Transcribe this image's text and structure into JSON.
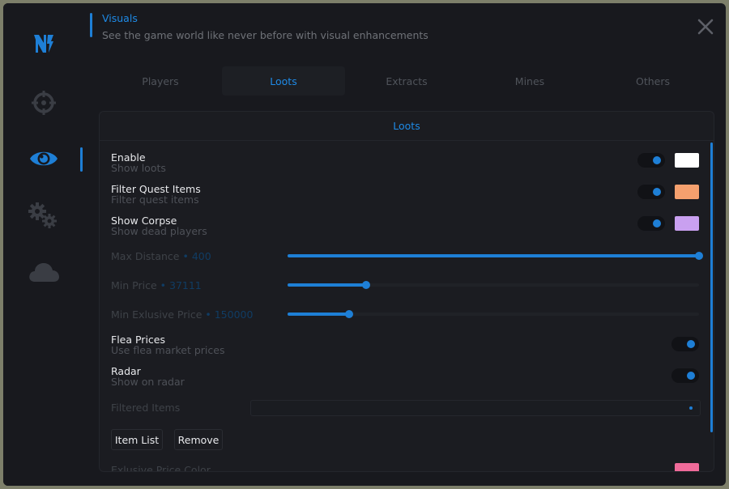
{
  "header": {
    "title": "Visuals",
    "subtitle": "See the game world like never before with visual enhancements"
  },
  "sidebar": {
    "items": [
      {
        "name": "logo-icon",
        "active": false
      },
      {
        "name": "crosshair-icon",
        "active": false
      },
      {
        "name": "eye-icon",
        "active": true
      },
      {
        "name": "gears-icon",
        "active": false
      },
      {
        "name": "cloud-icon",
        "active": false
      }
    ]
  },
  "tabs": [
    {
      "label": "Players",
      "active": false
    },
    {
      "label": "Loots",
      "active": true
    },
    {
      "label": "Extracts",
      "active": false
    },
    {
      "label": "Mines",
      "active": false
    },
    {
      "label": "Others",
      "active": false
    }
  ],
  "panel": {
    "title": "Loots",
    "enable": {
      "label": "Enable",
      "desc": "Show loots",
      "on": true,
      "color": "#ffffff"
    },
    "filter_quest": {
      "label": "Filter Quest Items",
      "desc": "Filter quest items",
      "on": true,
      "color": "#f5a06e"
    },
    "show_corpse": {
      "label": "Show Corpse",
      "desc": "Show dead players",
      "on": true,
      "color": "#c9a0f0"
    },
    "max_distance": {
      "label": "Max Distance",
      "value": "400",
      "fraction": 1.0
    },
    "min_price": {
      "label": "Min Price",
      "value": "37111",
      "fraction": 0.19
    },
    "min_exclusive_price": {
      "label": "Min Exlusive Price",
      "value": "150000",
      "fraction": 0.15
    },
    "flea_prices": {
      "label": "Flea Prices",
      "desc": "Use flea market prices",
      "on": true
    },
    "radar": {
      "label": "Radar",
      "desc": "Show on radar",
      "on": true
    },
    "filtered_items": {
      "label": "Filtered Items",
      "value": ""
    },
    "item_list_button": "Item List",
    "remove_button": "Remove",
    "exclusive_price_color": {
      "label": "Exlusive Price Color",
      "color": "#f06b9a"
    }
  },
  "colors": {
    "accent": "#1e7fd6",
    "background": "#18191e"
  }
}
